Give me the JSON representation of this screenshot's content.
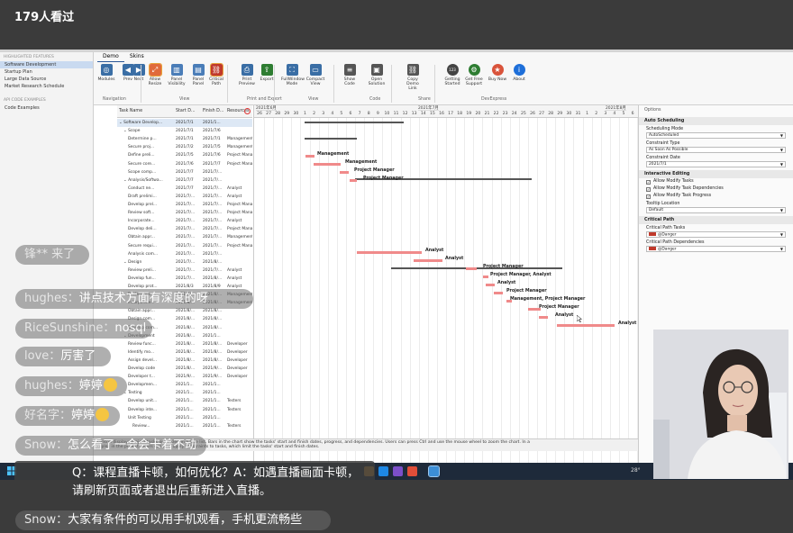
{
  "viewer_count": "179人看过",
  "ribbon": {
    "tabs": [
      "Demo",
      "Skins"
    ],
    "buttons": [
      {
        "name": "modules",
        "label": "Modules",
        "color": "#3a6ea5"
      },
      {
        "name": "prev",
        "label": "Prev",
        "color": "#3a6ea5"
      },
      {
        "name": "next",
        "label": "Next",
        "color": "#3a6ea5"
      },
      {
        "name": "allow-resize",
        "label": "Allow Resize",
        "color": "#e06a3b"
      },
      {
        "name": "panel-visibility",
        "label": "Panel Visibility",
        "color": "#4a7db8"
      },
      {
        "name": "panel-panel",
        "label": "Panel Panel",
        "color": "#4a7db8"
      },
      {
        "name": "critical-path",
        "label": "Critical Path",
        "color": "#c0392b"
      },
      {
        "name": "print-preview",
        "label": "Print Preview",
        "color": "#3a6ea5"
      },
      {
        "name": "export",
        "label": "Export",
        "color": "#2e7d32"
      },
      {
        "name": "fullwindow-mode",
        "label": "FullWindow Mode",
        "color": "#3a6ea5"
      },
      {
        "name": "compact-view",
        "label": "Compact View",
        "color": "#3a6ea5"
      },
      {
        "name": "show-code",
        "label": "Show Code",
        "color": "#555555"
      },
      {
        "name": "open-solution",
        "label": "Open Solution",
        "color": "#555555"
      },
      {
        "name": "copy-demo-link",
        "label": "Copy Demo Link",
        "color": "#555555"
      },
      {
        "name": "getting-started",
        "label": "Getting Started",
        "color": "#444444"
      },
      {
        "name": "get-free-support",
        "label": "Get Free Support",
        "color": "#2e7d32"
      },
      {
        "name": "buy-now",
        "label": "Buy Now",
        "color": "#d9533b"
      },
      {
        "name": "about",
        "label": "About",
        "color": "#1e6fd9"
      }
    ],
    "groups": [
      "Navigation",
      "View",
      "Print and Export",
      "View",
      "Code",
      "Share",
      "DevExpress"
    ]
  },
  "leftnav": {
    "section1": "HIGHLIGHTED FEATURES",
    "items": [
      "Software Development",
      "Startup Plan",
      "Large Data Source",
      "Market Research Schedule"
    ],
    "section2": "API CODE EXAMPLES",
    "items2": [
      "Code Examples"
    ]
  },
  "grid": {
    "headers": [
      "Task Name",
      "Start D...",
      "Finish D...",
      "Resources"
    ],
    "rows": [
      [
        "Software Develop...",
        "2021/7/1",
        "2021/1...",
        ""
      ],
      [
        "Scope",
        "2021/7/1",
        "2021/7/6",
        ""
      ],
      [
        "Determine p...",
        "2021/7/1",
        "2021/7/1",
        "Management"
      ],
      [
        "Secure proj...",
        "2021/7/2",
        "2021/7/5",
        "Management"
      ],
      [
        "Define preli...",
        "2021/7/5",
        "2021/7/6",
        "Project Manager"
      ],
      [
        "Secure core...",
        "2021/7/6",
        "2021/7/7",
        "Project Manager"
      ],
      [
        "Scope comp...",
        "2021/7/7",
        "2021/7/...",
        ""
      ],
      [
        "Analysis/Softwa...",
        "2021/7/7",
        "2021/7/...",
        ""
      ],
      [
        "Conduct ne...",
        "2021/7/7",
        "2021/7/...",
        "Analyst"
      ],
      [
        "Draft prelimi...",
        "2021/7/...",
        "2021/7/...",
        "Analyst"
      ],
      [
        "Develop prel...",
        "2021/7/...",
        "2021/7/...",
        "Project Manager"
      ],
      [
        "Review soft...",
        "2021/7/...",
        "2021/7/...",
        "Project Manag..."
      ],
      [
        "Incorporate...",
        "2021/7/...",
        "2021/7/...",
        "Analyst"
      ],
      [
        "Develop deli...",
        "2021/7/...",
        "2021/7/...",
        "Project Manager"
      ],
      [
        "Obtain appr...",
        "2021/7/...",
        "2021/7/...",
        "Management,..."
      ],
      [
        "Secure requi...",
        "2021/7/...",
        "2021/7/...",
        "Project Manager"
      ],
      [
        "Analysis com...",
        "2021/7/...",
        "2021/7/...",
        ""
      ],
      [
        "Design",
        "2021/7/...",
        "2021/8/...",
        ""
      ],
      [
        "Review preli...",
        "2021/7/...",
        "2021/7/...",
        "Analyst"
      ],
      [
        "Develop fun...",
        "2021/7/...",
        "2021/8/...",
        "Analyst"
      ],
      [
        "Develop prot...",
        "2021/8/3",
        "2021/8/9",
        "Analyst"
      ],
      [
        "Review func...",
        "2021/8/...",
        "2021/8/...",
        "Management"
      ],
      [
        "Incorporate...",
        "2021/8/...",
        "2021/8/...",
        "Management"
      ],
      [
        "Obtain appr...",
        "2021/8/...",
        "2021/8/...",
        ""
      ],
      [
        "Design com...",
        "2021/8/...",
        "2021/8/...",
        ""
      ],
      [
        "Develop com...",
        "2021/8/...",
        "2021/8/...",
        ""
      ],
      [
        "Development",
        "2021/8/...",
        "2021/1...",
        ""
      ],
      [
        "Review func...",
        "2021/8/...",
        "2021/8/...",
        "Developer"
      ],
      [
        "Identify mo...",
        "2021/8/...",
        "2021/8/...",
        "Developer"
      ],
      [
        "Assign devel...",
        "2021/8/...",
        "2021/8/...",
        "Developer"
      ],
      [
        "Develop code",
        "2021/8/...",
        "2021/9/...",
        "Developer"
      ],
      [
        "Developer t...",
        "2021/9/...",
        "2021/9/...",
        "Developer"
      ],
      [
        "Developmen...",
        "2021/1...",
        "2021/1...",
        ""
      ],
      [
        "Testing",
        "2021/1...",
        "2021/1...",
        ""
      ],
      [
        "Develop unit...",
        "2021/1...",
        "2021/1...",
        "Testers"
      ],
      [
        "Develop inte...",
        "2021/1...",
        "2021/1...",
        "Testers"
      ],
      [
        "Unit Testing",
        "2021/1...",
        "2021/1...",
        ""
      ],
      [
        "Review...",
        "2021/1...",
        "2021/1...",
        "Testers"
      ]
    ]
  },
  "timeline": {
    "months": [
      "2021年6月",
      "2021年7月",
      "2021年8月"
    ],
    "days": [
      "26",
      "27",
      "28",
      "29",
      "30",
      "1",
      "2",
      "3",
      "4",
      "5",
      "6",
      "7",
      "8",
      "9",
      "10",
      "11",
      "12",
      "13",
      "14",
      "15",
      "16",
      "17",
      "18",
      "19",
      "20",
      "21",
      "22",
      "23",
      "24",
      "25",
      "26",
      "27",
      "28",
      "29",
      "30",
      "31",
      "1",
      "2",
      "3",
      "4",
      "5",
      "6"
    ],
    "bar_labels": [
      "Management",
      "Management",
      "Project Manager",
      "Project Manager",
      "Analyst",
      "Analyst",
      "Project Manager",
      "Project Manager, Analyst",
      "Analyst",
      "Project Manager",
      "Management, Project Manager",
      "Project Manager",
      "Analyst",
      "Analyst"
    ]
  },
  "options": {
    "title": "Options",
    "auto_scheduling": "Auto Scheduling",
    "scheduling_mode_label": "Scheduling Mode",
    "scheduling_mode_value": "AutoScheduled",
    "constraint_type_label": "Constraint Type",
    "constraint_type_value": "As Soon As Possible",
    "constraint_date_label": "Constraint Date",
    "constraint_date_value": "2021/7/1",
    "interactive_editing": "Interactive Editing",
    "checks": [
      "Allow Modify Tasks",
      "Allow Modify Task Dependencies",
      "Allow Modify Task Progress"
    ],
    "tooltip_location_label": "Tooltip Location",
    "tooltip_location_value": "Default",
    "critical_path": "Critical Path",
    "cp_tasks_label": "Critical Path Tasks",
    "cp_tasks_value": "@Danger",
    "cp_deps_label": "Critical Path Dependencies",
    "cp_deps_value": "@Danger"
  },
  "status_text": "control displays project tasks organized in a tree list. Bars in the chart show the tasks' start and finish dates, progress, and dependencies. Users can press Ctrl and use the mouse wheel to zoom the chart. In a",
  "status_text2": "mples in the project. Users can also apply constraints to tasks, which limit the tasks' start and finish dates.",
  "tray_text": "28°",
  "chat": [
    {
      "nick": "锋** 来了",
      "msg": ""
    },
    {
      "nick": "hughes：",
      "msg": "讲点技术方面有深度的呀"
    },
    {
      "nick": "RiceSunshine：",
      "msg": "nosql"
    },
    {
      "nick": "love：",
      "msg": "厉害了"
    },
    {
      "nick": "hughes：",
      "msg": "婷婷"
    },
    {
      "nick": "好名字：",
      "msg": "婷婷"
    },
    {
      "nick": "Snow：",
      "msg": "怎么看了一会会卡着不动"
    },
    {
      "nick": "Snow：",
      "msg": "大家有条件的可以用手机观看，手机更流畅些"
    }
  ],
  "qa_text": "Q：课程直播卡顿，如何优化？A：如遇直播画面卡顿，请刷新页面或者退出后重新进入直播。",
  "colors": {
    "bar": "#f08a8a",
    "accent": "#2b5797",
    "critical": "#c0392b"
  }
}
